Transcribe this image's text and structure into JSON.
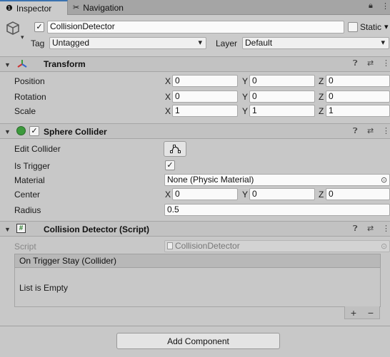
{
  "tabs": {
    "inspector": "Inspector",
    "navigation": "Navigation"
  },
  "header": {
    "object_name": "CollisionDetector",
    "active": true,
    "static_label": "Static",
    "tag_label": "Tag",
    "tag_value": "Untagged",
    "layer_label": "Layer",
    "layer_value": "Default"
  },
  "transform": {
    "title": "Transform",
    "position_label": "Position",
    "rotation_label": "Rotation",
    "scale_label": "Scale",
    "axis_x": "X",
    "axis_y": "Y",
    "axis_z": "Z",
    "position": {
      "x": "0",
      "y": "0",
      "z": "0"
    },
    "rotation": {
      "x": "0",
      "y": "0",
      "z": "0"
    },
    "scale": {
      "x": "1",
      "y": "1",
      "z": "1"
    }
  },
  "sphere_collider": {
    "title": "Sphere Collider",
    "enabled": true,
    "edit_collider_label": "Edit Collider",
    "is_trigger_label": "Is Trigger",
    "is_trigger": true,
    "material_label": "Material",
    "material_value": "None (Physic Material)",
    "center_label": "Center",
    "center": {
      "x": "0",
      "y": "0",
      "z": "0"
    },
    "radius_label": "Radius",
    "radius_value": "0.5"
  },
  "collision_script": {
    "title": "Collision Detector (Script)",
    "script_label": "Script",
    "script_value": "CollisionDetector",
    "event_header": "On Trigger Stay (Collider)",
    "event_empty": "List is Empty",
    "add_symbol": "+",
    "remove_symbol": "−"
  },
  "add_component_label": "Add Component",
  "colors": {
    "accent": "#3a72b0",
    "panel": "#c8c8c8",
    "header_bg": "#c2c2c2"
  }
}
